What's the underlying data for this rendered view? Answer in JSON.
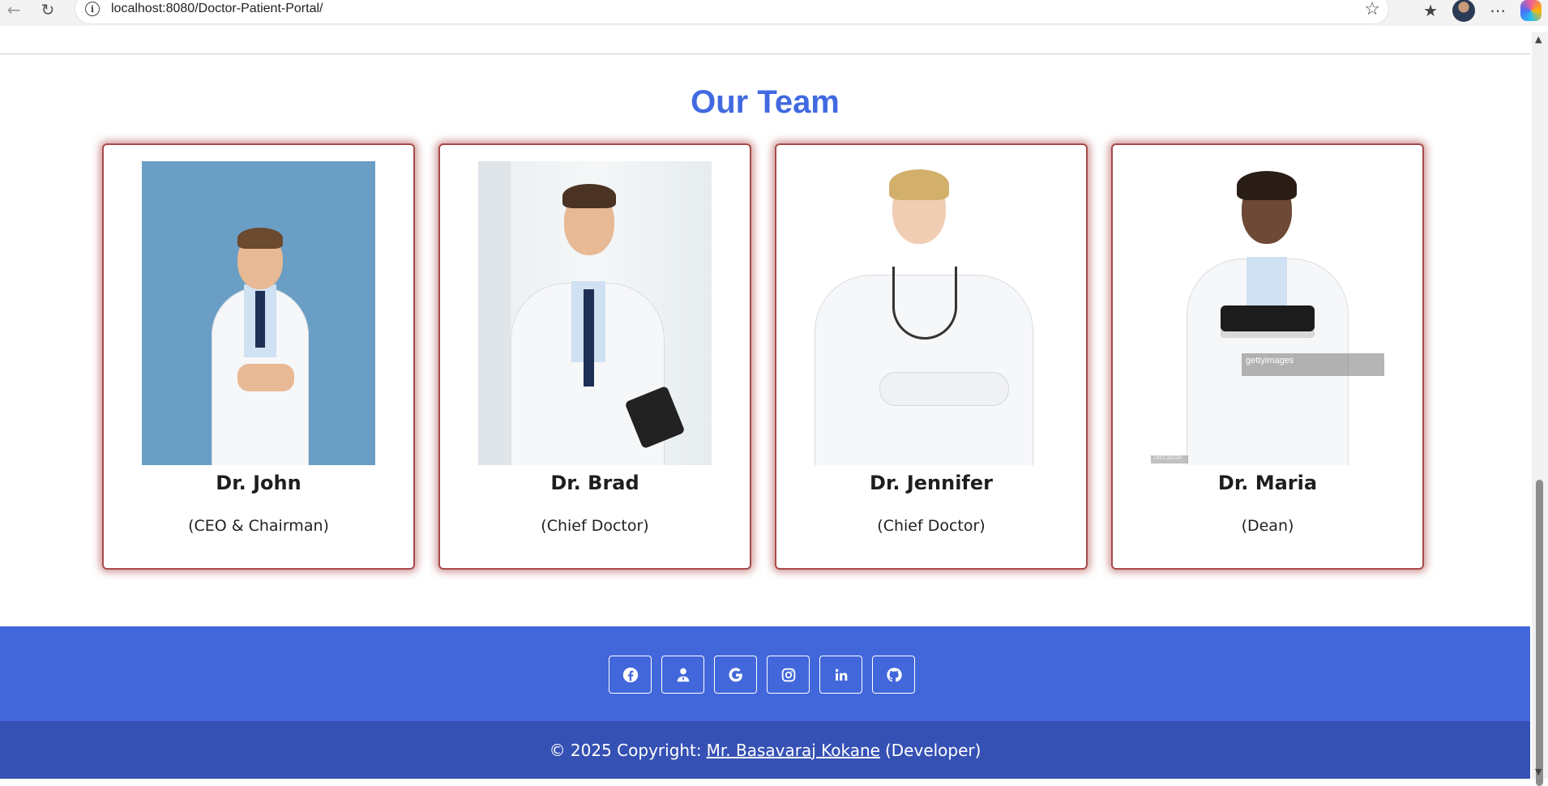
{
  "browser": {
    "url": "localhost:8080/Doctor-Patient-Portal/"
  },
  "team": {
    "title": "Our Team",
    "members": [
      {
        "name": "Dr. John",
        "role": "(CEO & Chairman)"
      },
      {
        "name": "Dr. Brad",
        "role": "(Chief Doctor)"
      },
      {
        "name": "Dr. Jennifer",
        "role": "(Chief Doctor)"
      },
      {
        "name": "Dr. Maria",
        "role": "(Dean)"
      }
    ],
    "watermark_text": "gettyimages",
    "watermark_id": "149138234"
  },
  "footer": {
    "social": [
      "facebook-icon",
      "user-icon",
      "google-icon",
      "instagram-icon",
      "linkedin-icon",
      "github-icon"
    ],
    "copyright_prefix": "© 2025 Copyright:",
    "developer_link": "Mr. Basavaraj Kokane",
    "copyright_suffix": "(Developer)"
  },
  "colors": {
    "accent": "#4169e1",
    "footer_top": "#4267db",
    "footer_bottom": "#3651b4",
    "card_glow": "#a84b4b"
  }
}
